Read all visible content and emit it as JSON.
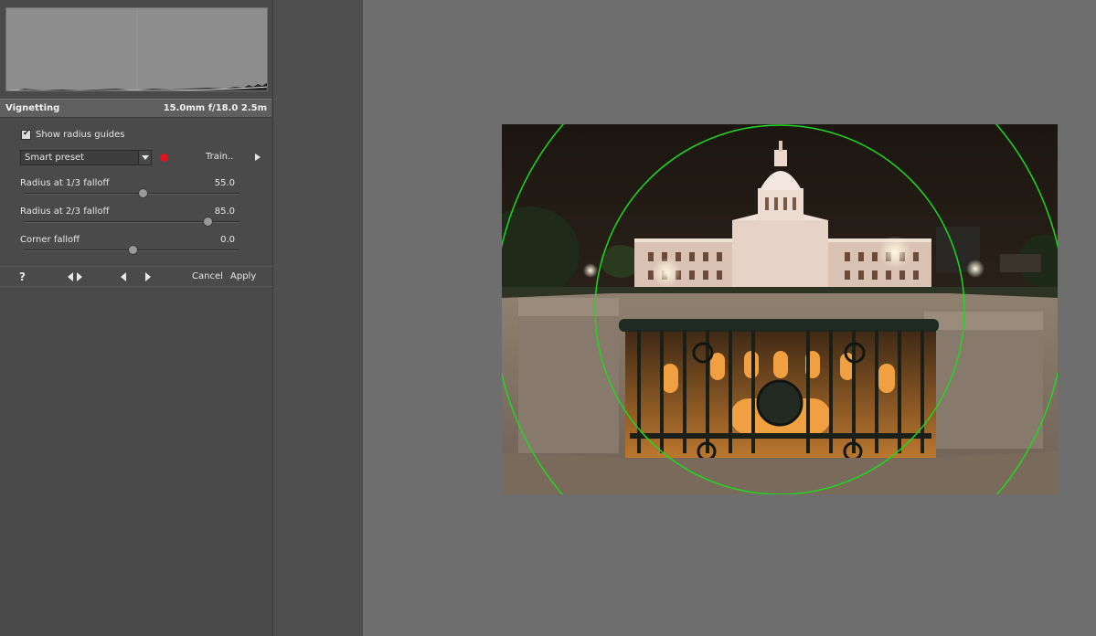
{
  "panel": {
    "section_title": "Vignetting",
    "lens_info": "15.0mm f/18.0 2.5m",
    "show_guides_label": "Show radius guides",
    "show_guides_checked": true,
    "preset_value": "Smart preset",
    "train_label": "Train..",
    "sliders": [
      {
        "label": "Radius at 1/3 falloff",
        "value": "55.0",
        "fraction": 0.55
      },
      {
        "label": "Radius at 2/3 falloff",
        "value": "85.0",
        "fraction": 0.85
      },
      {
        "label": "Corner falloff",
        "value": "0.0",
        "fraction": 0.5
      }
    ],
    "help_label": "?",
    "cancel_label": "Cancel",
    "apply_label": "Apply"
  },
  "colors": {
    "guide_circle": "#1ed81e",
    "record_dot": "#e0141a",
    "panel_bg": "#4a4a4a",
    "canvas_bg": "#6e6e6e"
  },
  "icons": {
    "compare": "compare-arrows-icon",
    "prev": "previous-icon",
    "next": "next-icon",
    "train": "play-arrow-icon"
  }
}
